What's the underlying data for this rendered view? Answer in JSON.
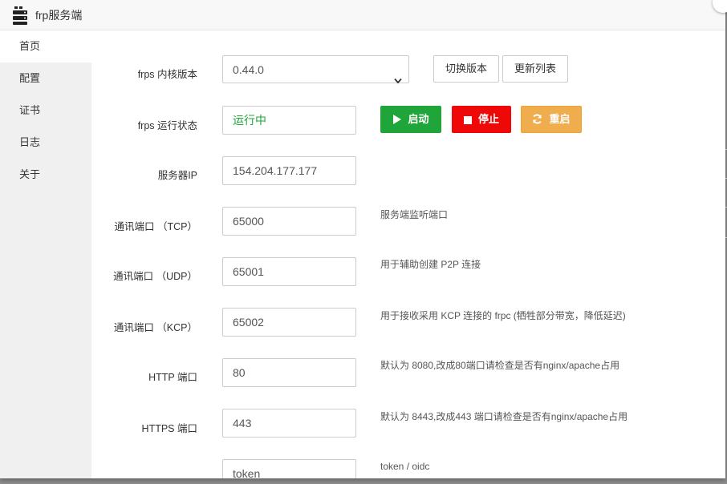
{
  "window": {
    "title": "frp服务端"
  },
  "sidebar": {
    "items": [
      {
        "label": "首页"
      },
      {
        "label": "配置"
      },
      {
        "label": "证书"
      },
      {
        "label": "日志"
      },
      {
        "label": "关于"
      }
    ]
  },
  "form": {
    "version_label": "frps 内核版本",
    "version_selected": "0.44.0",
    "switch_version_btn": "切换版本",
    "update_list_btn": "更新列表",
    "status_label": "frps 运行状态",
    "status_value": "运行中",
    "status_color": "#20a53a",
    "start_btn": "启动",
    "stop_btn": "停止",
    "restart_btn": "重启",
    "server_ip_label": "服务器IP",
    "server_ip_value": "154.204.177.177",
    "tcp_label": "通讯端口 （TCP）",
    "tcp_value": "65000",
    "tcp_help": "服务端监听端口",
    "udp_label": "通讯端口 （UDP）",
    "udp_value": "65001",
    "udp_help": "用于辅助创建 P2P 连接",
    "kcp_label": "通讯端口 （KCP）",
    "kcp_value": "65002",
    "kcp_help": "用于接收采用 KCP 连接的 frpc (牺牲部分带宽，降低延迟)",
    "http_label": "HTTP 端口",
    "http_value": "80",
    "http_help": "默认为 8080,改成80端口请检查是否有nginx/apache占用",
    "https_label": "HTTPS 端口",
    "https_value": "443",
    "https_help": "默认为 8443,改成443 端口请检查是否有nginx/apache占用",
    "auth_value": "token",
    "auth_help": "token / oidc"
  },
  "colors": {
    "success": "#20a53a",
    "danger": "#ef0808",
    "warning": "#f0ad4e"
  },
  "icons": {
    "app": "server-icon",
    "start": "play-icon",
    "stop": "stop-icon",
    "restart": "refresh-icon",
    "select": "chevron-down-icon"
  }
}
